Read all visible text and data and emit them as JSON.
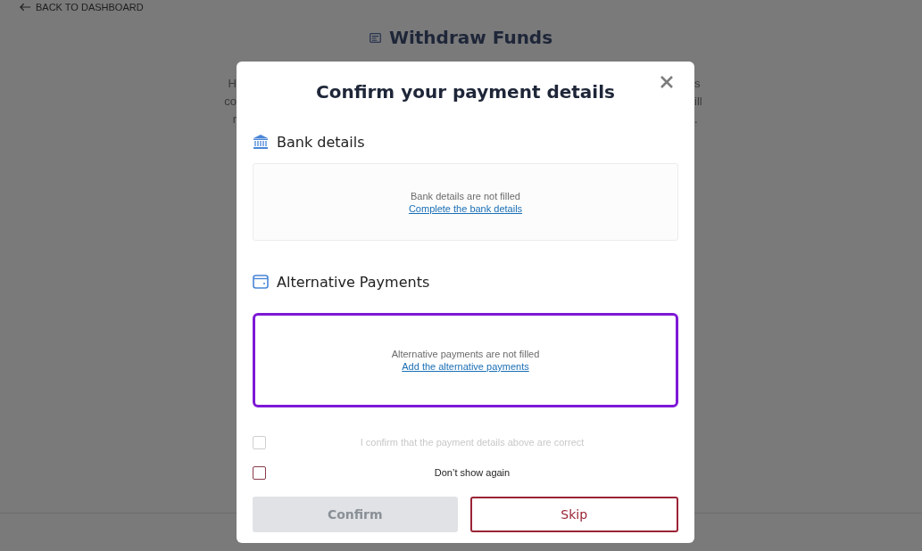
{
  "page": {
    "back_link": "BACK TO DASHBOARD",
    "title": "Withdraw Funds",
    "intro_fragments": [
      {
        "left": "H",
        "right": "s"
      },
      {
        "left": "co",
        "right": "ill"
      },
      {
        "left": "r",
        "right": "."
      }
    ]
  },
  "modal": {
    "title": "Confirm your payment details",
    "sections": [
      {
        "kind": "bank",
        "heading": "Bank details",
        "message": "Bank details are not filled",
        "link": "Complete the bank details",
        "highlighted": false
      },
      {
        "kind": "wallet",
        "heading": "Alternative Payments",
        "message": "Alternative payments are not filled",
        "link": "Add the alternative payments",
        "highlighted": true
      }
    ],
    "checkboxes": [
      {
        "label": "I confirm that the payment details above are correct",
        "checked": false,
        "disabled": true
      },
      {
        "label": "Don’t show again",
        "checked": false,
        "disabled": false
      }
    ],
    "buttons": [
      {
        "label": "Confirm",
        "kind": "primary",
        "disabled": true
      },
      {
        "label": "Skip",
        "kind": "secondary",
        "disabled": false
      }
    ]
  }
}
